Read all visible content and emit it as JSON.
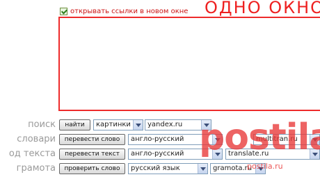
{
  "header": {
    "new_window_checkbox_label": "открывать ссылки в новом окне",
    "title": "ОДНО ОКНО"
  },
  "rows": {
    "search": {
      "label": "поиск",
      "button": "найти",
      "type_select": "картинки",
      "engine_select": "yandex.ru"
    },
    "dictionaries": {
      "label": "словари",
      "button": "перевести слово",
      "direction_select": "англо-русский",
      "service_select": "multitran.ru"
    },
    "text_translation": {
      "label": "од текста",
      "button": "перевести текст",
      "direction_select": "англо-русский",
      "service_select": "translate.ru"
    },
    "gramota": {
      "label": "грамота",
      "button": "проверить слово",
      "language_select": "русский язык",
      "service_select": "gramota.ru"
    }
  },
  "watermark": {
    "logo": "postila",
    "site": "postila.ru"
  },
  "colors": {
    "accent_red": "#ee2b2b",
    "label_gray": "#9a9a9a"
  }
}
